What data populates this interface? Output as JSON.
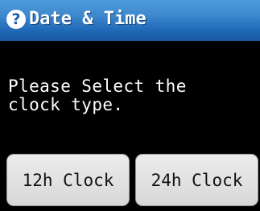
{
  "header": {
    "help_icon": "?",
    "title": "Date & Time"
  },
  "main": {
    "message": "Please Select the\nclock type."
  },
  "buttons": {
    "twelve_hour_label": "12h Clock",
    "twenty_four_hour_label": "24h Clock"
  },
  "colors": {
    "titlebar": "#2f78c4",
    "background": "#000000",
    "button": "#e0e0e0"
  }
}
